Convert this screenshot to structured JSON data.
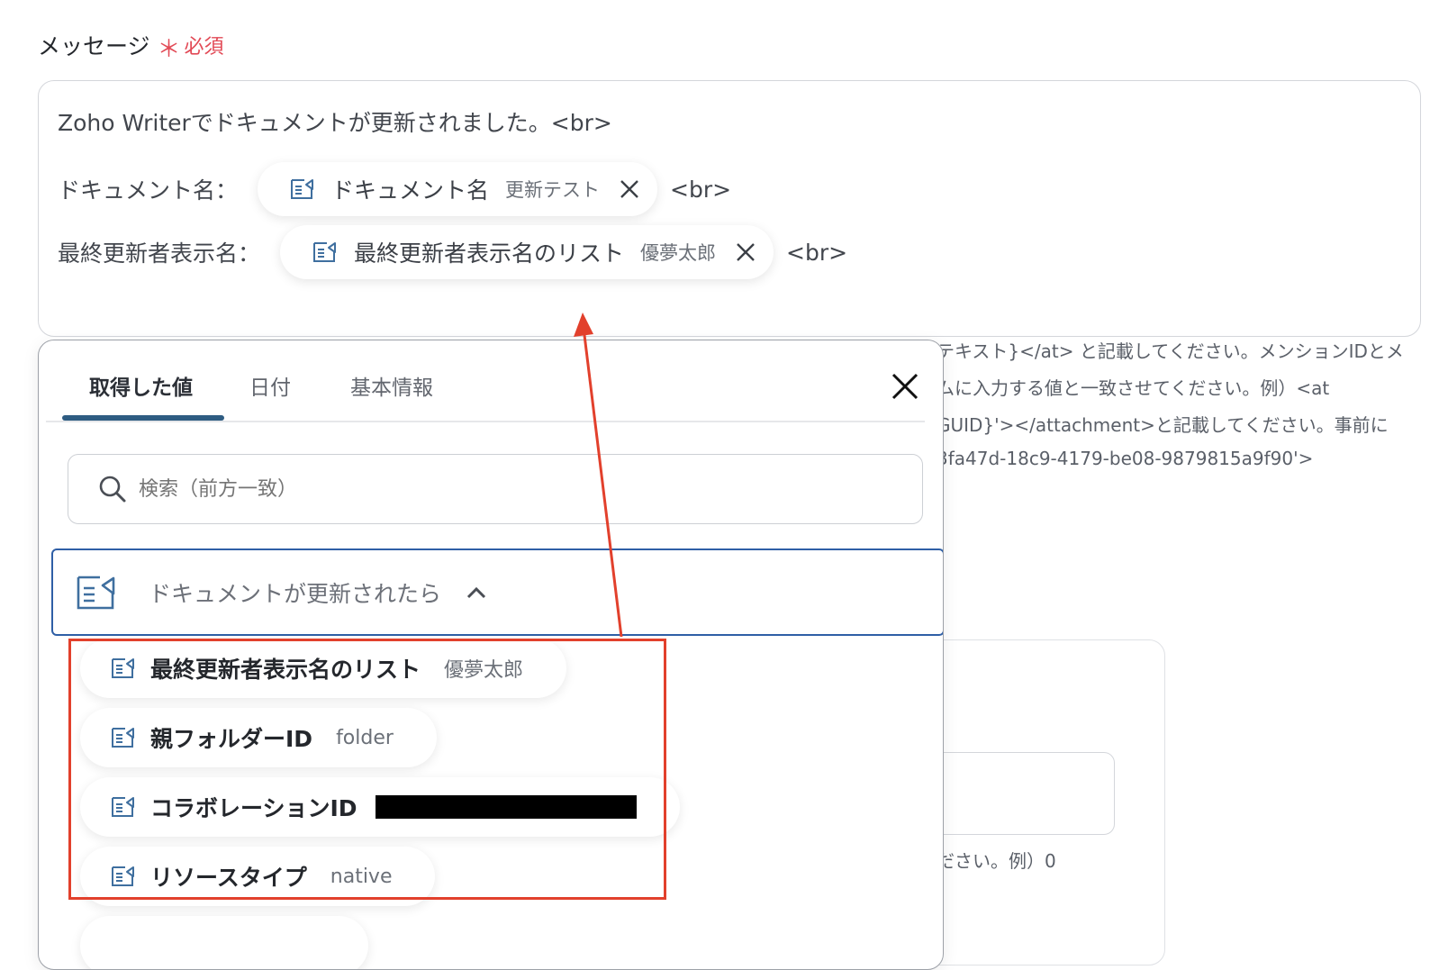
{
  "field": {
    "label": "メッセージ",
    "required_mark": "＊",
    "required_text": "必須"
  },
  "message": {
    "line1": "Zoho Writerでドキュメントが更新されました。<br>",
    "line2_prefix": "ドキュメント名：",
    "line2_chip_name": "ドキュメント名",
    "line2_chip_value": "更新テスト",
    "line2_suffix": "<br>",
    "line3_prefix": "最終更新者表示名：",
    "line3_chip_name": "最終更新者表示名のリスト",
    "line3_chip_value": "優夢太郎",
    "line3_suffix": "<br>"
  },
  "help_lines": [
    "テキスト}</at> と記載してください。メンションIDとメ",
    "ムに入力する値と一致させてください。例）<at",
    "GUID}'></attachment>と記載してください。事前に",
    "3fa47d-18c9-4179-be08-9879815a9f90'>"
  ],
  "background_hint": "ださい。例）0",
  "popup": {
    "tabs": [
      "取得した値",
      "日付",
      "基本情報"
    ],
    "active_tab": 0,
    "search_placeholder": "検索（前方一致）",
    "section_label": "ドキュメントが更新されたら",
    "items": [
      {
        "name": "最終更新者表示名のリスト",
        "value": "優夢太郎"
      },
      {
        "name": "親フォルダーID",
        "value": "folder"
      },
      {
        "name": "コラボレーションID",
        "value": ""
      },
      {
        "name": "リソースタイプ",
        "value": "native"
      }
    ]
  },
  "colors": {
    "required": "#e24a56",
    "tab_underline": "#2e5c82",
    "section_border": "#2f5fa6",
    "annotation": "#e2402c",
    "icon": "#3f6f9f"
  }
}
